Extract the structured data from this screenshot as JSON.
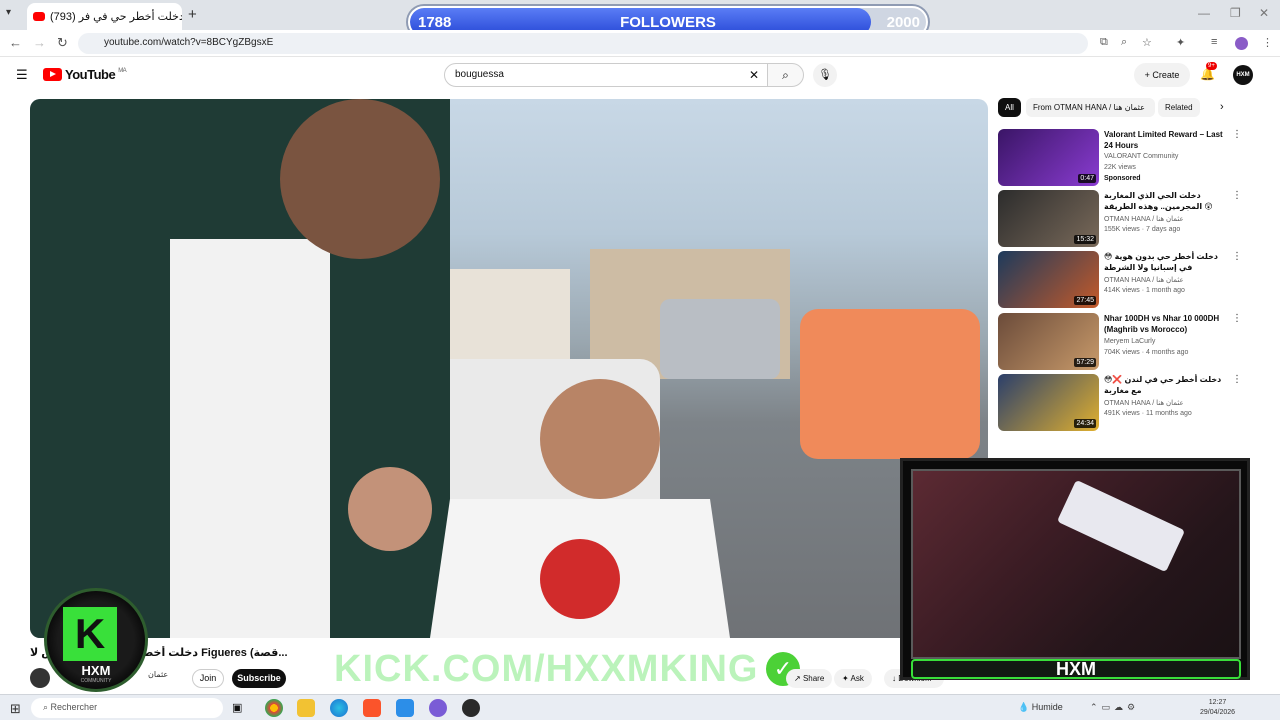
{
  "browser": {
    "tab_title": "(793) دخلت أخطر حي في فر...",
    "new_tab": "+",
    "url": "youtube.com/watch?v=8BCYgZBgsxE"
  },
  "followers_overlay": {
    "current": "1788",
    "label": "FOLLOWERS",
    "goal": "2000",
    "progress": 0.894
  },
  "youtube": {
    "logo_text": "YouTube",
    "region": "MA",
    "search_value": "bouguessa",
    "create_label": "Create",
    "notif_count": "9+",
    "avatar_text": "HXM"
  },
  "video": {
    "title": "دخلت أخطر حي في فيغيراس لا Figueres (قصة...",
    "channel": "عثمان",
    "join": "Join",
    "subscribe": "Subscribe",
    "share": "Share",
    "ask": "Ask",
    "download": "Downlo..."
  },
  "overlay": {
    "kick_url": "KICK.COM/HXXMKING",
    "logo_text": "HXM",
    "logo_sub": "COMMUNITY",
    "cam_label": "HXM"
  },
  "sidebar": {
    "chips": [
      "All",
      "From OTMAN HANA / عثمان هنا",
      "Related"
    ],
    "recs": [
      {
        "title": "Valorant Limited Reward – Last 24 Hours",
        "channel": "VALORANT Community",
        "meta": "22K views",
        "extra": "Sponsored",
        "duration": "0:47"
      },
      {
        "title": "دخلت الحي الذي المغاربة المجرمين.. وهذه الطريقة 😲",
        "channel": "OTMAN HANA / عثمان هنا",
        "meta": "155K views · 7 days ago",
        "duration": "15:32"
      },
      {
        "title": "😳 دخلت أخطر حي بدون هوية في إسبانيا ولا الشرطة",
        "channel": "OTMAN HANA / عثمان هنا",
        "meta": "414K views · 1 month ago",
        "duration": "27:45"
      },
      {
        "title": "Nhar 100DH vs Nhar 10 000DH (Maghrib vs Morocco)",
        "channel": "Meryem LaCurly",
        "meta": "704K views · 4 months ago",
        "duration": "57:29"
      },
      {
        "title": "😳❌ دخلت أخطر حي في لندن مع مغاربة",
        "channel": "OTMAN HANA / عثمان هنا",
        "meta": "491K views · 11 months ago",
        "duration": "24:34"
      }
    ]
  },
  "taskbar": {
    "search_placeholder": "Rechercher",
    "weather": "Humide",
    "time": "12:27",
    "date": "29/04/2026"
  }
}
